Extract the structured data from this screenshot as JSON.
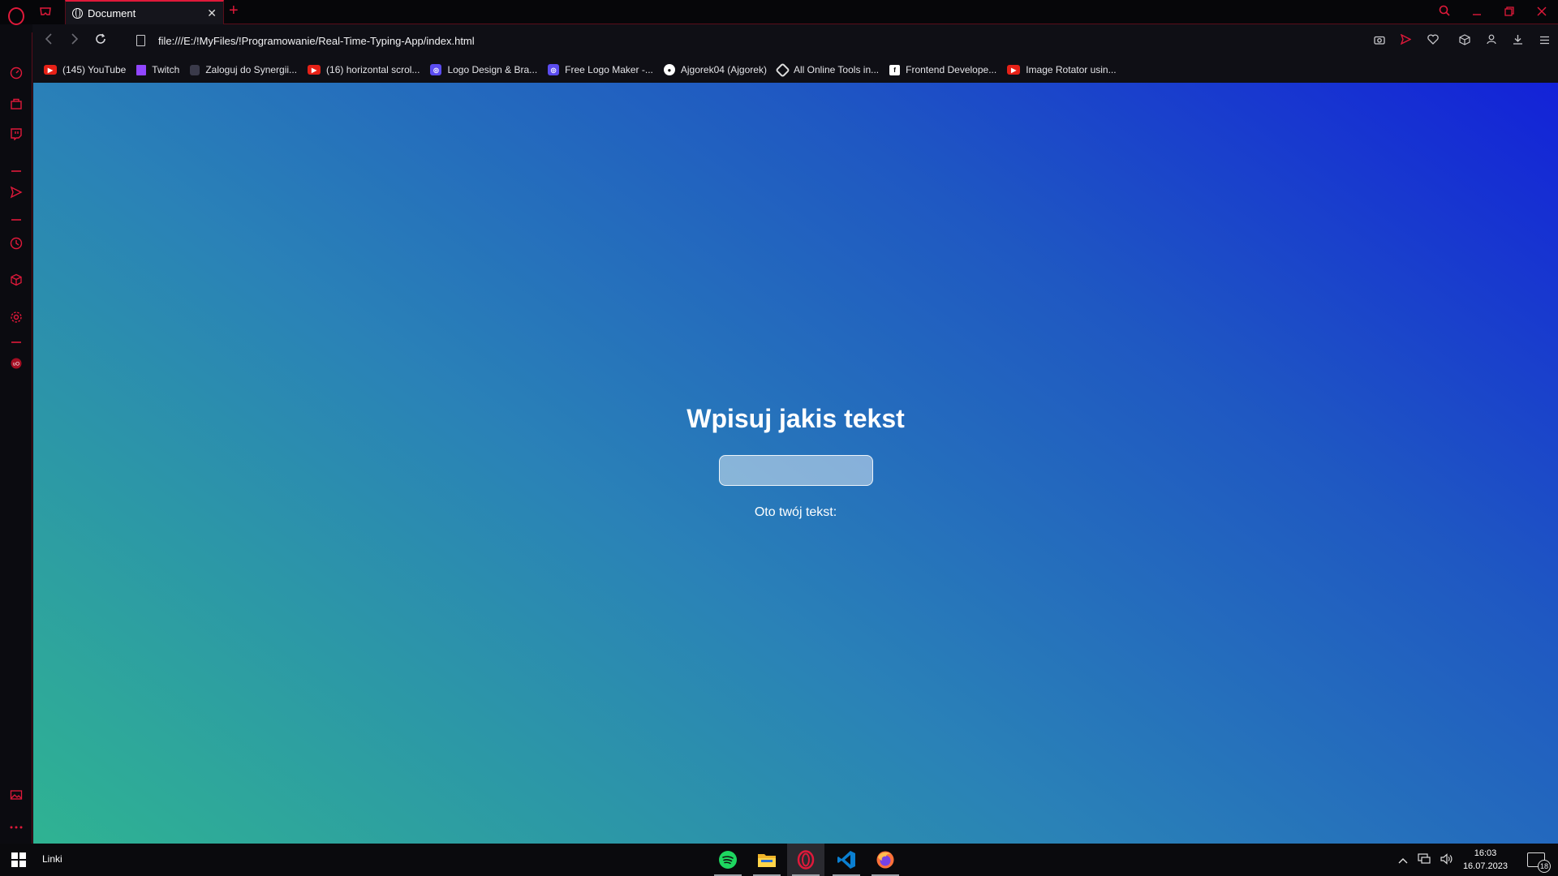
{
  "browser": {
    "tab_title": "Document",
    "close_glyph": "✕",
    "new_tab_glyph": "+",
    "url": "file:///E:/!MyFiles/!Programowanie/Real-Time-Typing-App/index.html",
    "accent_color": "#e0193a"
  },
  "bookmarks": [
    {
      "label": "(145) YouTube",
      "icon": "youtube-icon"
    },
    {
      "label": "Twitch",
      "icon": "twitch-icon"
    },
    {
      "label": "Zaloguj do Synergii...",
      "icon": "synergia-icon"
    },
    {
      "label": "(16) horizontal scrol...",
      "icon": "youtube-icon"
    },
    {
      "label": "Logo Design & Bra...",
      "icon": "logo-design-icon"
    },
    {
      "label": "Free Logo Maker -...",
      "icon": "logo-maker-icon"
    },
    {
      "label": "Ajgorek04 (Ajgorek)",
      "icon": "github-icon"
    },
    {
      "label": "All Online Tools in...",
      "icon": "tools-icon"
    },
    {
      "label": "Frontend Develope...",
      "icon": "frontend-mentor-icon"
    },
    {
      "label": "Image Rotator usin...",
      "icon": "youtube-icon"
    }
  ],
  "page": {
    "heading": "Wpisuj jakis tekst",
    "input_value": "",
    "result_label": "Oto twój tekst:",
    "gradient_colors": [
      "#2fb392",
      "#2a82b7",
      "#1f58c2",
      "#1322d8"
    ]
  },
  "taskbar": {
    "linki": "Linki",
    "time": "16:03",
    "date": "16.07.2023",
    "notifications": "18"
  }
}
